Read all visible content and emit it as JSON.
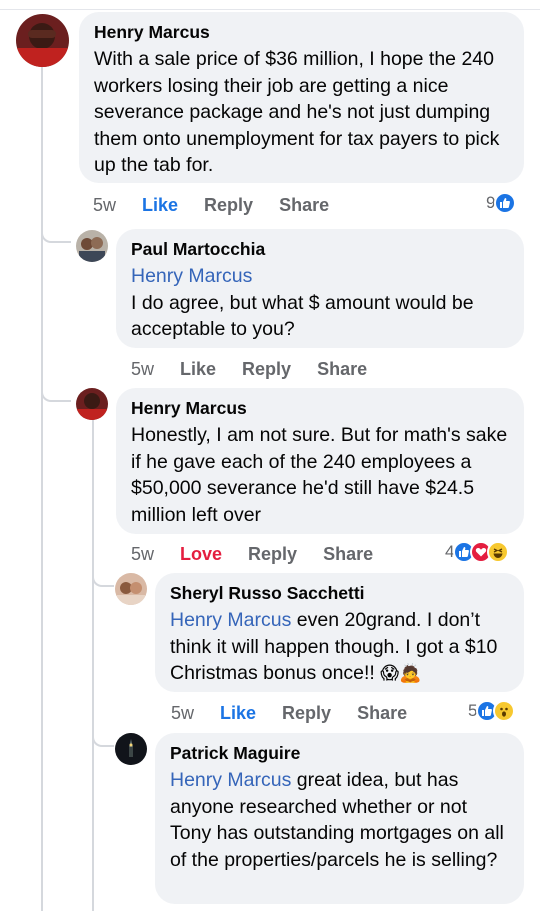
{
  "comments": [
    {
      "author": "Henry Marcus",
      "text": "With a sale price of $36 million, I hope the 240 workers losing their job are getting a nice severance package and he's not just dumping them onto unemployment for tax payers to pick up the tab for.",
      "time": "5w",
      "like": "Like",
      "reply": "Reply",
      "share": "Share",
      "reaction_count": "9",
      "reactions": [
        "like-icon"
      ]
    },
    {
      "author": "Paul Martocchia",
      "mention": "Henry Marcus",
      "text": " I do agree, but what $ amount would be acceptable to you?",
      "time": "5w",
      "like": "Like",
      "reply": "Reply",
      "share": "Share"
    },
    {
      "author": "Henry Marcus",
      "text": "Honestly, I am not sure. But for math's sake if he gave each of the 240 employees a $50,000 severance he'd still have $24.5 million left over",
      "time": "5w",
      "like": "Love",
      "reply": "Reply",
      "share": "Share",
      "reaction_count": "4",
      "reactions": [
        "like-icon",
        "love-icon",
        "haha-icon"
      ]
    },
    {
      "author": "Sheryl Russo Sacchetti",
      "mention": "Henry Marcus",
      "text": " even 20grand.  I don’t think it will happen though.  I got a $10 Christmas bonus once!!",
      "emoji": "😱🙇",
      "time": "5w",
      "like": "Like",
      "reply": "Reply",
      "share": "Share",
      "reaction_count": "5",
      "reactions": [
        "like-icon",
        "wow-icon"
      ]
    },
    {
      "author": "Patrick Maguire",
      "mention": "Henry Marcus",
      "text": " great idea, but has anyone researched whether or not Tony has outstanding mortgages on all of the properties/parcels he is selling?"
    }
  ],
  "colors": {
    "like_blue": "#1b74e4",
    "love_red": "#e41e3f",
    "mention_blue": "#3565b9",
    "bubble_gray": "#f0f2f5",
    "meta_gray": "#65676b"
  }
}
